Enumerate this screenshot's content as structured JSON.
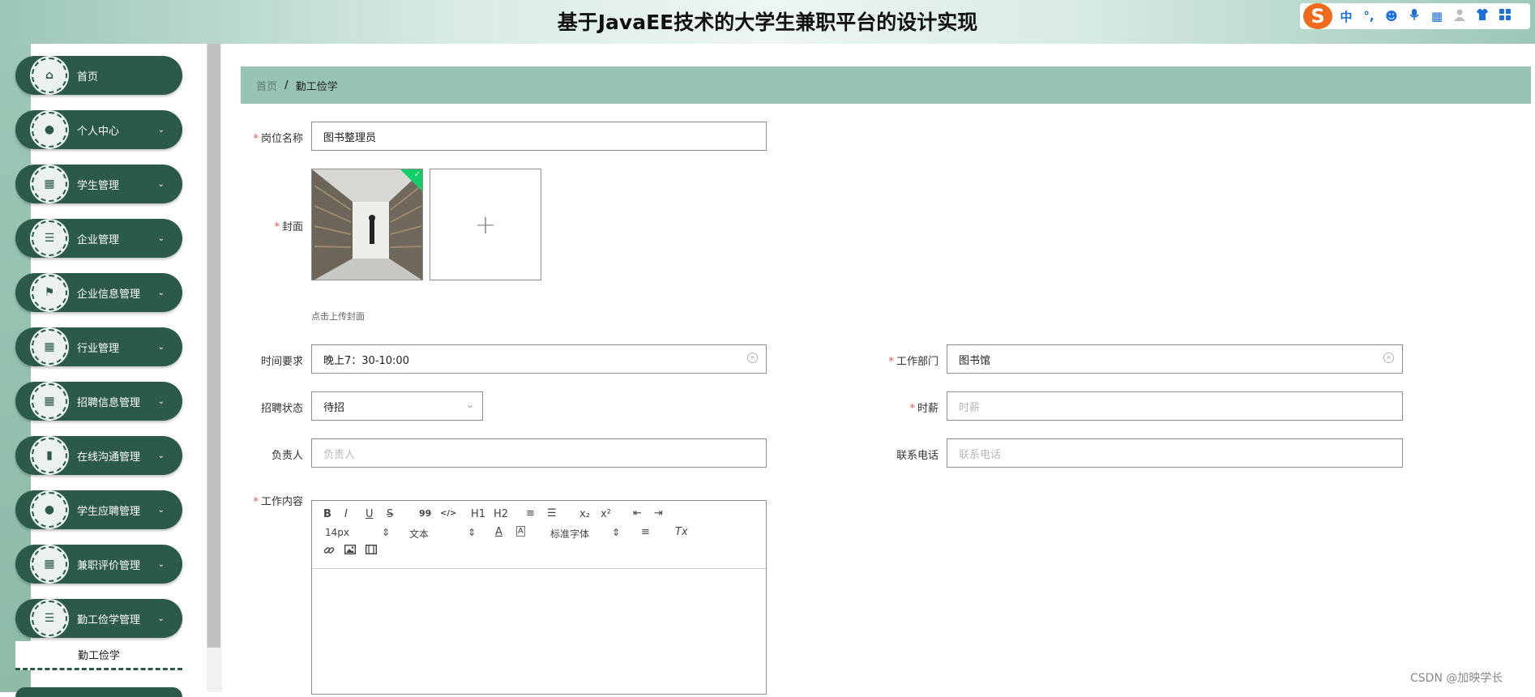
{
  "header": {
    "title": "基于JavaEE技术的大学生兼职平台的设计实现"
  },
  "ime_toolbar": {
    "logo": "S",
    "items": [
      {
        "icon": "chinese-mode-icon",
        "glyph": "中"
      },
      {
        "icon": "punctuation-icon",
        "glyph": "°,"
      },
      {
        "icon": "emoji-icon",
        "glyph": "☻"
      },
      {
        "icon": "microphone-icon",
        "glyph": "🎙"
      },
      {
        "icon": "keyboard-icon",
        "glyph": "▦"
      },
      {
        "icon": "user-icon",
        "glyph": "👤"
      },
      {
        "icon": "skin-icon",
        "glyph": "👕"
      },
      {
        "icon": "apps-icon",
        "glyph": "▣"
      }
    ]
  },
  "sidebar": {
    "items": [
      {
        "label": "首页",
        "icon": "home-icon",
        "glyph": "⌂",
        "has_arrow": false
      },
      {
        "label": "个人中心",
        "icon": "person-icon",
        "glyph": "●",
        "has_arrow": true
      },
      {
        "label": "学生管理",
        "icon": "grid-icon",
        "glyph": "▦",
        "has_arrow": true
      },
      {
        "label": "企业管理",
        "icon": "list-icon",
        "glyph": "☰",
        "has_arrow": true
      },
      {
        "label": "企业信息管理",
        "icon": "flag-icon",
        "glyph": "⚑",
        "has_arrow": true
      },
      {
        "label": "行业管理",
        "icon": "grid-icon",
        "glyph": "▦",
        "has_arrow": true
      },
      {
        "label": "招聘信息管理",
        "icon": "grid-icon",
        "glyph": "▦",
        "has_arrow": true
      },
      {
        "label": "在线沟通管理",
        "icon": "bar-chart-icon",
        "glyph": "▮",
        "has_arrow": true
      },
      {
        "label": "学生应聘管理",
        "icon": "person-icon",
        "glyph": "●",
        "has_arrow": true
      },
      {
        "label": "兼职评价管理",
        "icon": "grid-icon",
        "glyph": "▦",
        "has_arrow": true
      },
      {
        "label": "勤工俭学管理",
        "icon": "list-icon",
        "glyph": "☰",
        "has_arrow": true
      }
    ],
    "submenu_label": "勤工俭学",
    "arrow_glyph": "⌄"
  },
  "breadcrumb": {
    "home": "首页",
    "separator": "/",
    "current": "勤工俭学"
  },
  "form": {
    "required_mark": "*",
    "position_name": {
      "label": "岗位名称",
      "value": "图书整理员"
    },
    "cover": {
      "label": "封面",
      "hint": "点击上传封面",
      "upload_glyph": "+"
    },
    "time_req": {
      "label": "时间要求",
      "value": "晚上7：30-10:00"
    },
    "department": {
      "label": "工作部门",
      "value": "图书馆"
    },
    "recruit_status": {
      "label": "招聘状态",
      "value": "待招"
    },
    "hourly_pay": {
      "label": "时薪",
      "placeholder": "时薪"
    },
    "person_in_charge": {
      "label": "负责人",
      "placeholder": "负责人"
    },
    "phone": {
      "label": "联系电话",
      "placeholder": "联系电话"
    },
    "content": {
      "label": "工作内容"
    }
  },
  "editor_toolbar": {
    "bold": "B",
    "italic": "I",
    "underline": "U",
    "strike": "S",
    "quote": "99",
    "code": "</>",
    "h1": "H1",
    "h2": "H2",
    "ordered": "≡",
    "bullet": "☰",
    "sub": "x₂",
    "sup": "x²",
    "outdent": "⇤",
    "indent": "⇥",
    "size": "14px",
    "text_style": "文本",
    "color": "A",
    "bg": "A",
    "font": "标准字体",
    "align": "≡",
    "clear": "Tx",
    "link": "🔗",
    "image": "▣",
    "video": "▤"
  },
  "watermark": "CSDN @加映学长",
  "colors": {
    "sidebar_green": "#2b5a48",
    "breadcrumb_bg": "#97c4b3",
    "required": "#e9544a"
  }
}
